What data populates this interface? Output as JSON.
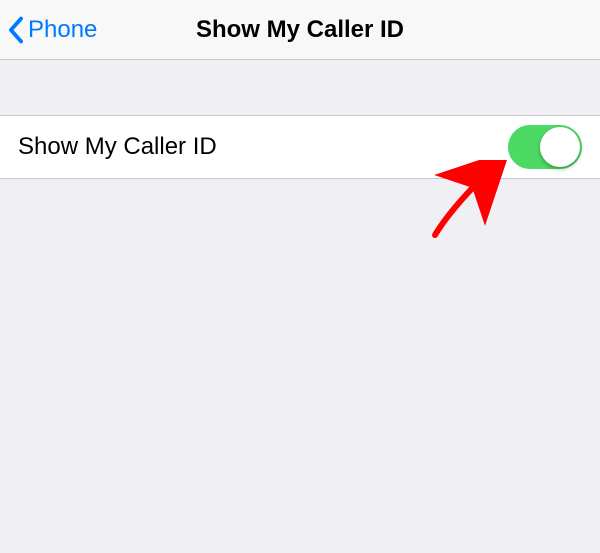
{
  "nav": {
    "back_label": "Phone",
    "title": "Show My Caller ID"
  },
  "settings": {
    "caller_id": {
      "label": "Show My Caller ID",
      "enabled": true
    }
  },
  "colors": {
    "link": "#007aff",
    "toggle_on": "#4cd964"
  }
}
